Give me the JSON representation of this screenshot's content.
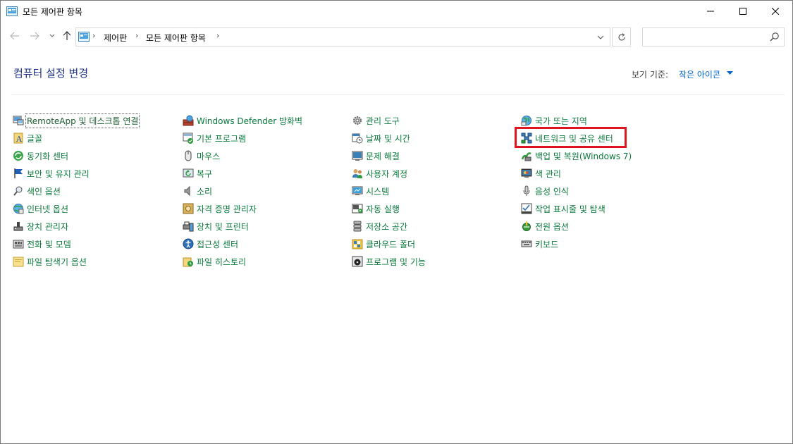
{
  "window": {
    "title": "모든 제어판 항목"
  },
  "navigation": {
    "breadcrumbs": [
      "제어판",
      "모든 제어판 항목"
    ],
    "search": {
      "value": "",
      "placeholder": ""
    }
  },
  "content": {
    "title": "컴퓨터 설정 변경",
    "view_by_label": "보기 기준:",
    "view_by_value": "작은 아이콘"
  },
  "items": {
    "col1": [
      {
        "label": "RemoteApp 및 데스크톱 연결",
        "icon": "remoteapp-icon"
      },
      {
        "label": "글꼴",
        "icon": "fonts-icon"
      },
      {
        "label": "동기화 센터",
        "icon": "sync-center-icon"
      },
      {
        "label": "보안 및 유지 관리",
        "icon": "flag-icon"
      },
      {
        "label": "색인 옵션",
        "icon": "indexing-icon"
      },
      {
        "label": "인터넷 옵션",
        "icon": "internet-options-icon"
      },
      {
        "label": "장치 관리자",
        "icon": "device-manager-icon"
      },
      {
        "label": "전화 및 모뎀",
        "icon": "phone-modem-icon"
      },
      {
        "label": "파일 탐색기 옵션",
        "icon": "folder-options-icon"
      }
    ],
    "col2": [
      {
        "label": "Windows Defender 방화벽",
        "icon": "firewall-icon"
      },
      {
        "label": "기본 프로그램",
        "icon": "default-programs-icon"
      },
      {
        "label": "마우스",
        "icon": "mouse-icon"
      },
      {
        "label": "복구",
        "icon": "recovery-icon"
      },
      {
        "label": "소리",
        "icon": "sound-icon"
      },
      {
        "label": "자격 증명 관리자",
        "icon": "credential-manager-icon"
      },
      {
        "label": "장치 및 프린터",
        "icon": "devices-printers-icon"
      },
      {
        "label": "접근성 센터",
        "icon": "ease-of-access-icon"
      },
      {
        "label": "파일 히스토리",
        "icon": "file-history-icon"
      }
    ],
    "col3": [
      {
        "label": "관리 도구",
        "icon": "admin-tools-icon"
      },
      {
        "label": "날짜 및 시간",
        "icon": "date-time-icon"
      },
      {
        "label": "문제 해결",
        "icon": "troubleshooting-icon"
      },
      {
        "label": "사용자 계정",
        "icon": "user-accounts-icon"
      },
      {
        "label": "시스템",
        "icon": "system-icon"
      },
      {
        "label": "자동 실행",
        "icon": "autoplay-icon"
      },
      {
        "label": "저장소 공간",
        "icon": "storage-spaces-icon"
      },
      {
        "label": "클라우드 폴더",
        "icon": "work-folders-icon"
      },
      {
        "label": "프로그램 및 기능",
        "icon": "programs-features-icon"
      }
    ],
    "col4": [
      {
        "label": "국가 또는 지역",
        "icon": "region-icon"
      },
      {
        "label": "네트워크 및 공유 센터",
        "icon": "network-sharing-icon"
      },
      {
        "label": "백업 및 복원(Windows 7)",
        "icon": "backup-restore-icon"
      },
      {
        "label": "색 관리",
        "icon": "color-management-icon"
      },
      {
        "label": "음성 인식",
        "icon": "speech-recognition-icon"
      },
      {
        "label": "작업 표시줄 및 탐색",
        "icon": "taskbar-icon"
      },
      {
        "label": "전원 옵션",
        "icon": "power-options-icon"
      },
      {
        "label": "키보드",
        "icon": "keyboard-icon"
      }
    ]
  },
  "colors": {
    "item_text": "#0a7a3c",
    "title_text": "#1e3287",
    "link_blue": "#0066cc",
    "highlight": "#e0141e"
  }
}
